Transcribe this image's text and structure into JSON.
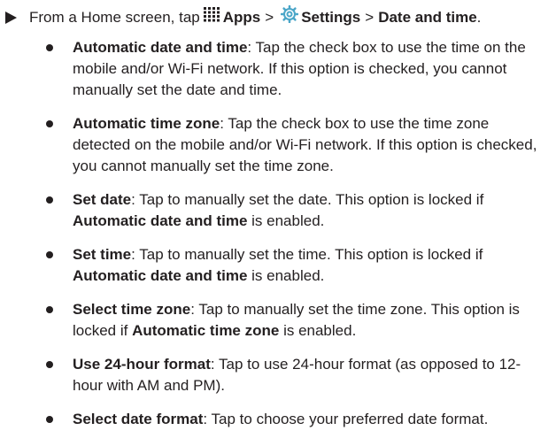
{
  "step": {
    "prefix": "From a Home screen, tap",
    "apps_icon": "apps-grid-icon",
    "apps_label": "Apps",
    "sep1": ">",
    "settings_icon": "settings-gear-icon",
    "settings_label": "Settings",
    "sep2": ">",
    "target_label": "Date and time",
    "end": "."
  },
  "items": [
    {
      "term": "Automatic date and time",
      "text": ": Tap the check box to use the time on the mobile and/or Wi-Fi network. If this option is checked, you cannot manually set the date and time."
    },
    {
      "term": "Automatic time zone",
      "text": ": Tap the check box to use the time zone detected on the mobile and/or Wi-Fi network. If this option is checked, you cannot manually set the time zone."
    },
    {
      "term": "Set date",
      "text": ": Tap to manually set the date. This option is locked if ",
      "ref": "Automatic date and time",
      "tail": " is enabled."
    },
    {
      "term": "Set time",
      "text": ": Tap to manually set the time. This option is locked if ",
      "ref": "Automatic date and time",
      "tail": " is enabled."
    },
    {
      "term": "Select time zone",
      "text": ": Tap to manually set the time zone. This option is locked if ",
      "ref": "Automatic time zone",
      "tail": " is enabled."
    },
    {
      "term": "Use 24-hour format",
      "text": ": Tap to use 24-hour format (as opposed to 12-hour with AM and PM)."
    },
    {
      "term": "Select date format",
      "text": ": Tap to choose your preferred date format."
    }
  ]
}
